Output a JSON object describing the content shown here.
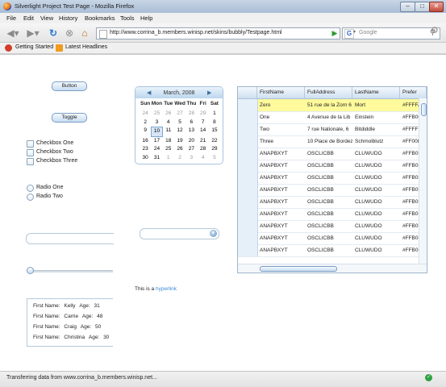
{
  "window": {
    "title": "Silverlight Project Test Page - Mozilla Firefox",
    "minimize": "–",
    "maximize": "□",
    "close": "✕"
  },
  "menubar": {
    "items": [
      "File",
      "Edit",
      "View",
      "History",
      "Bookmarks",
      "Tools",
      "Help"
    ]
  },
  "navbar": {
    "url": "http://www.corrina_b.members.winisp.net/skins/bubbly/Testpage.html",
    "search_placeholder": "Google",
    "icons": [
      "back-icon",
      "forward-icon",
      "reload-icon",
      "stop-icon",
      "home-icon",
      "go-icon",
      "gear-icon"
    ]
  },
  "bookmarks": {
    "items": [
      "Getting Started",
      "Latest Headlines"
    ]
  },
  "controls": {
    "button_label": "Button",
    "toggle_label": "Toggle",
    "checkboxes": [
      "Checkbox One",
      "Checkbox Two",
      "Checkbox Three"
    ],
    "radios": [
      "Radio One",
      "Radio Two"
    ],
    "hyperlink_prefix": "This is a",
    "hyperlink_label": "hyperlink"
  },
  "calendar": {
    "title": "March, 2008",
    "prev": "◀",
    "next": "▶",
    "days_of_week": [
      "Sun",
      "Mon",
      "Tue",
      "Wed",
      "Thu",
      "Fri",
      "Sat"
    ],
    "weeks": [
      [
        "24",
        "25",
        "26",
        "27",
        "28",
        "29",
        "1"
      ],
      [
        "2",
        "3",
        "4",
        "5",
        "6",
        "7",
        "8"
      ],
      [
        "9",
        "10",
        "11",
        "12",
        "13",
        "14",
        "15"
      ],
      [
        "16",
        "17",
        "18",
        "19",
        "20",
        "21",
        "22"
      ],
      [
        "23",
        "24",
        "25",
        "26",
        "27",
        "28",
        "29"
      ],
      [
        "30",
        "31",
        "1",
        "2",
        "3",
        "4",
        "5"
      ]
    ],
    "today": "10"
  },
  "grid": {
    "columns": [
      "FirstName",
      "FullAddress",
      "LastName",
      "Prefer"
    ],
    "rows": [
      [
        "Zero",
        "51 rue de la Zorn 6",
        "Mort",
        "#FFFFA"
      ],
      [
        "One",
        "4 Avenue de la Lib",
        "Einstein",
        "#FFB00"
      ],
      [
        "Two",
        "7 rue Nationale, 6",
        "Bitdiddle",
        "#FFFFF"
      ],
      [
        "Three",
        "10 Place de Bordez",
        "Schmolblutz",
        "#FF008"
      ],
      [
        "ANAPBXYT",
        "OSCLICBB",
        "CLUWUDO",
        "#FFB05"
      ],
      [
        "ANAPBXYT",
        "OSCLICBB",
        "CLUWUDO",
        "#FFB05"
      ],
      [
        "ANAPBXYT",
        "OSCLICBB",
        "CLUWUDO",
        "#FFB05"
      ],
      [
        "ANAPBXYT",
        "OSCLICBB",
        "CLUWUDO",
        "#FFB05"
      ],
      [
        "ANAPBXYT",
        "OSCLICBB",
        "CLUWUDO",
        "#FFB05"
      ],
      [
        "ANAPBXYT",
        "OSCLICBB",
        "CLUWUDO",
        "#FFB05"
      ],
      [
        "ANAPBXYT",
        "OSCLICBB",
        "CLUWUDO",
        "#FFB05"
      ],
      [
        "ANAPBXYT",
        "OSCLICBB",
        "CLUWUDO",
        "#FFB05"
      ],
      [
        "ANAPBXYT",
        "OSCLICBB",
        "CLUWUDO",
        "#FFB05"
      ]
    ],
    "selected_row": 0,
    "selected_color": "#fffa9c"
  },
  "listbox": {
    "items": [
      {
        "first_label": "First Name:",
        "first": "Kelly",
        "age_label": "Age:",
        "age": "31"
      },
      {
        "first_label": "First Name:",
        "first": "Carrie",
        "age_label": "Age:",
        "age": "48"
      },
      {
        "first_label": "First Name:",
        "first": "Craig",
        "age_label": "Age:",
        "age": "50"
      },
      {
        "first_label": "First Name:",
        "first": "Christina",
        "age_label": "Age:",
        "age": "30"
      }
    ]
  },
  "status": {
    "text": "Transferring data from www.corrina_b.members.winisp.net...",
    "icon": "check-icon"
  },
  "slider": {
    "value": 0
  }
}
